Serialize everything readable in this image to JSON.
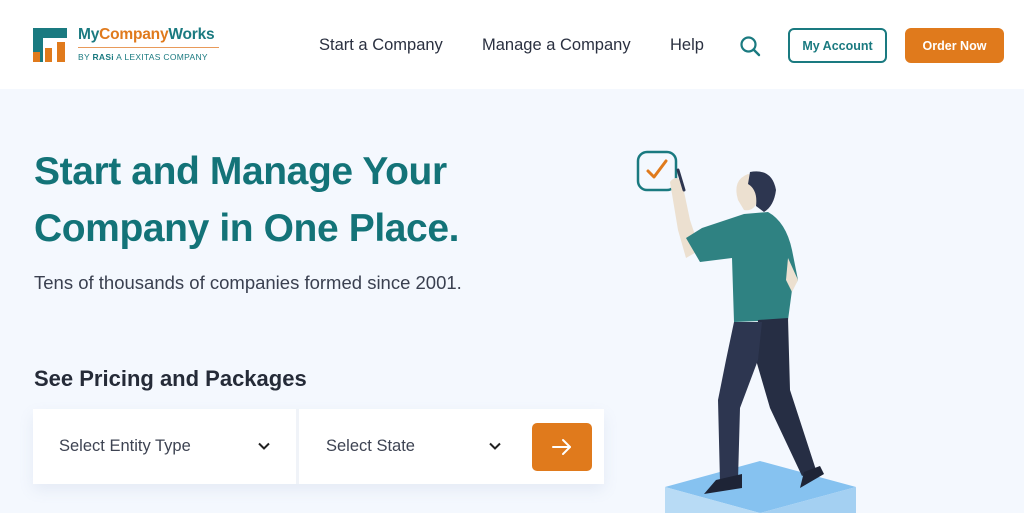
{
  "brand": {
    "name_part1": "My",
    "name_part2": "Company",
    "name_part3": "Works",
    "tagline_prefix": "BY ",
    "tagline_bold": "RASi",
    "tagline_rest": " A LEXITAS COMPANY",
    "colors": {
      "teal": "#1a7a80",
      "orange": "#e07a1c"
    }
  },
  "nav": {
    "items": [
      {
        "label": "Start a Company"
      },
      {
        "label": "Manage a Company"
      },
      {
        "label": "Help"
      }
    ],
    "search_icon": "search-icon",
    "my_account_label": "My Account",
    "order_now_label": "Order Now"
  },
  "hero": {
    "headline_line1": "Start and Manage Your",
    "headline_line2": "Company in One Place.",
    "subline": "Tens of thousands of companies formed since 2001."
  },
  "pricing": {
    "title": "See Pricing and Packages",
    "entity_select": {
      "value": "Select Entity Type"
    },
    "state_select": {
      "value": "Select State"
    },
    "submit_icon": "arrow-right-icon"
  },
  "illustration": {
    "subject": "person-checking-checkbox",
    "colors": {
      "shirt": "#2f8282",
      "pants": "#2d3650",
      "pedestal": "#86c2f0",
      "check": "#e07a1c"
    }
  }
}
